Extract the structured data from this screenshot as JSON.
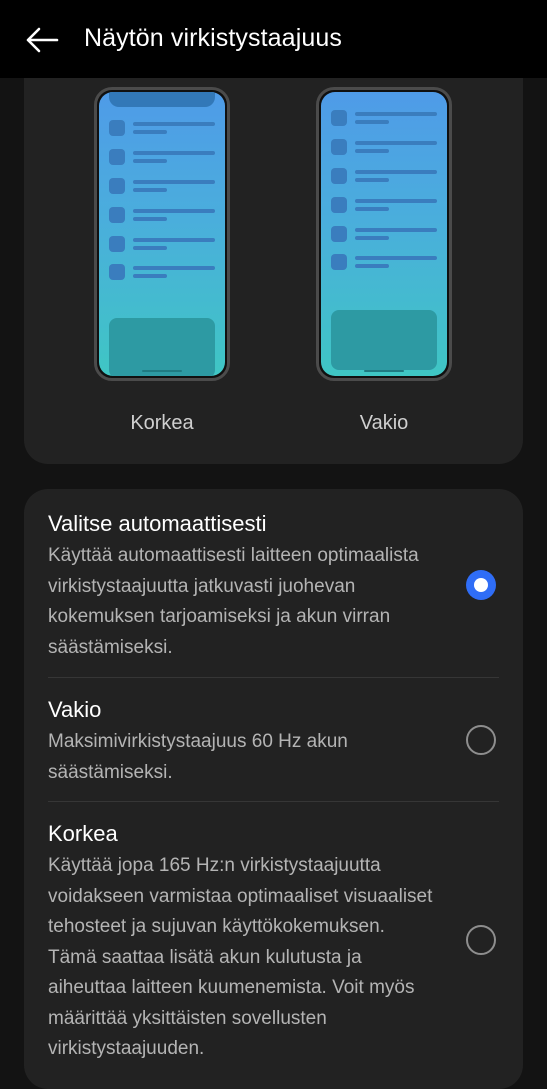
{
  "header": {
    "back_icon": "arrow-left-icon",
    "title": "Näytön virkistystaajuus"
  },
  "preview": {
    "phones": [
      {
        "label": "Korkea"
      },
      {
        "label": "Vakio"
      }
    ]
  },
  "options": [
    {
      "title": "Valitse automaattisesti",
      "description": "Käyttää automaattisesti laitteen optimaalista virkistystaajuutta jatkuvasti juohevan kokemuksen tarjoamiseksi ja akun virran säästämiseksi.",
      "selected": true
    },
    {
      "title": "Vakio",
      "description": "Maksimivirkistystaajuus 60 Hz akun säästämiseksi.",
      "selected": false
    },
    {
      "title": "Korkea",
      "description": "Käyttää jopa 165 Hz:n virkistystaajuutta voidakseen varmistaa optimaaliset visuaaliset tehosteet ja sujuvan käyttökokemuksen. Tämä saattaa lisätä akun kulutusta ja aiheuttaa laitteen kuumenemista. Voit myös määrittää yksittäisten sovellusten virkistystaajuuden.",
      "selected": false
    }
  ],
  "colors": {
    "accent": "#2f6df6",
    "background": "#131313",
    "card": "#222222"
  }
}
